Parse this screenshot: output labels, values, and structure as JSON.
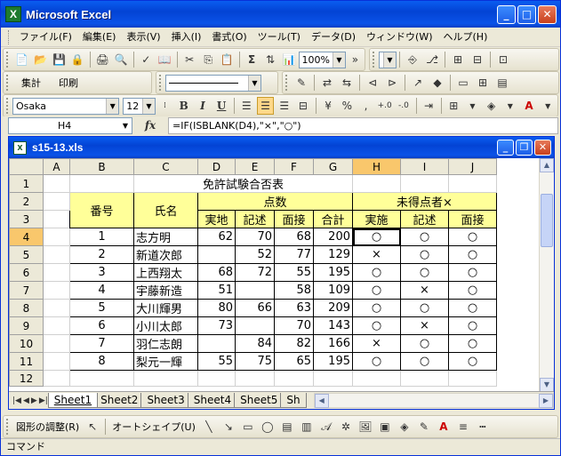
{
  "app": {
    "title": "Microsoft Excel",
    "icon_letter": "X"
  },
  "menu": {
    "items": [
      "ファイル(F)",
      "編集(E)",
      "表示(V)",
      "挿入(I)",
      "書式(O)",
      "ツール(T)",
      "データ(D)",
      "ウィンドウ(W)",
      "ヘルプ(H)"
    ]
  },
  "toolbar": {
    "zoom": "100%",
    "sum_label": "Σ",
    "sum_label2": "集計",
    "print_label": "印刷",
    "font_name": "Osaka",
    "font_size": "12",
    "bold": "B",
    "italic": "I",
    "underline": "U",
    "percent": "%",
    "comma": ",",
    "dec_inc": "+.0",
    "dec_dec": "-.0"
  },
  "formula_bar": {
    "cell_ref": "H4",
    "fx": "fx",
    "formula": "=IF(ISBLANK(D4),\"×\",\"○\")"
  },
  "workbook": {
    "title": "s15-13.xls",
    "columns": [
      "A",
      "B",
      "C",
      "D",
      "E",
      "F",
      "G",
      "H",
      "I",
      "J"
    ],
    "selected_column": "H",
    "selected_row": "4",
    "title_cell": "免許試験合否表",
    "headers": {
      "number": "番号",
      "name": "氏名",
      "score": "点数",
      "unscored": "未得点者×",
      "practical": "実地",
      "written": "記述",
      "interview": "面接",
      "total": "合計",
      "u_practical": "実施",
      "u_written": "記述",
      "u_interview": "面接"
    },
    "rows": [
      {
        "row": "4",
        "no": "1",
        "name": "志方明",
        "d": "62",
        "e": "70",
        "f": "68",
        "g": "200",
        "h": "○",
        "i": "○",
        "j": "○"
      },
      {
        "row": "5",
        "no": "2",
        "name": "新道次郎",
        "d": "",
        "e": "52",
        "f": "77",
        "g": "129",
        "h": "×",
        "i": "○",
        "j": "○"
      },
      {
        "row": "6",
        "no": "3",
        "name": "上西翔太",
        "d": "68",
        "e": "72",
        "f": "55",
        "g": "195",
        "h": "○",
        "i": "○",
        "j": "○"
      },
      {
        "row": "7",
        "no": "4",
        "name": "宇藤新造",
        "d": "51",
        "e": "",
        "f": "58",
        "g": "109",
        "h": "○",
        "i": "×",
        "j": "○"
      },
      {
        "row": "8",
        "no": "5",
        "name": "大川輝男",
        "d": "80",
        "e": "66",
        "f": "63",
        "g": "209",
        "h": "○",
        "i": "○",
        "j": "○"
      },
      {
        "row": "9",
        "no": "6",
        "name": "小川太郎",
        "d": "73",
        "e": "",
        "f": "70",
        "g": "143",
        "h": "○",
        "i": "×",
        "j": "○"
      },
      {
        "row": "10",
        "no": "7",
        "name": "羽仁志朗",
        "d": "",
        "e": "84",
        "f": "82",
        "g": "166",
        "h": "×",
        "i": "○",
        "j": "○"
      },
      {
        "row": "11",
        "no": "8",
        "name": "梨元一輝",
        "d": "55",
        "e": "75",
        "f": "65",
        "g": "195",
        "h": "○",
        "i": "○",
        "j": "○"
      }
    ],
    "row_labels": [
      "1",
      "2",
      "3",
      "12"
    ],
    "sheets": [
      "Sheet1",
      "Sheet2",
      "Sheet3",
      "Sheet4",
      "Sheet5",
      "Sh"
    ],
    "active_sheet": "Sheet1"
  },
  "drawing": {
    "adjust": "図形の調整(R)",
    "autoshape": "オートシェイプ(U)"
  },
  "status": {
    "text": "コマンド"
  }
}
